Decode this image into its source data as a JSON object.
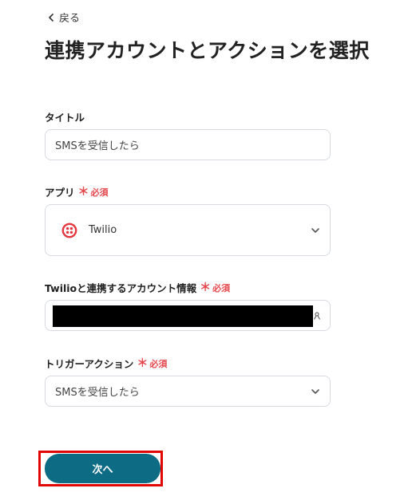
{
  "back": {
    "label": "戻る"
  },
  "page": {
    "title": "連携アカウントとアクションを選択"
  },
  "fields": {
    "title": {
      "label": "タイトル",
      "value": "SMSを受信したら"
    },
    "app": {
      "label": "アプリ",
      "required_mark": "＊",
      "required_text": "必須",
      "value": "Twilio",
      "icon": "twilio-logo-icon",
      "brand_color": "#e5363f"
    },
    "account": {
      "label": "Twilioと連携するアカウント情報",
      "required_mark": "＊",
      "required_text": "必須",
      "value_redacted": true
    },
    "trigger": {
      "label": "トリガーアクション",
      "required_mark": "＊",
      "required_text": "必須",
      "value": "SMSを受信したら"
    }
  },
  "actions": {
    "next_label": "次へ",
    "button_color": "#0e6b84",
    "highlight_color": "#e10600"
  }
}
